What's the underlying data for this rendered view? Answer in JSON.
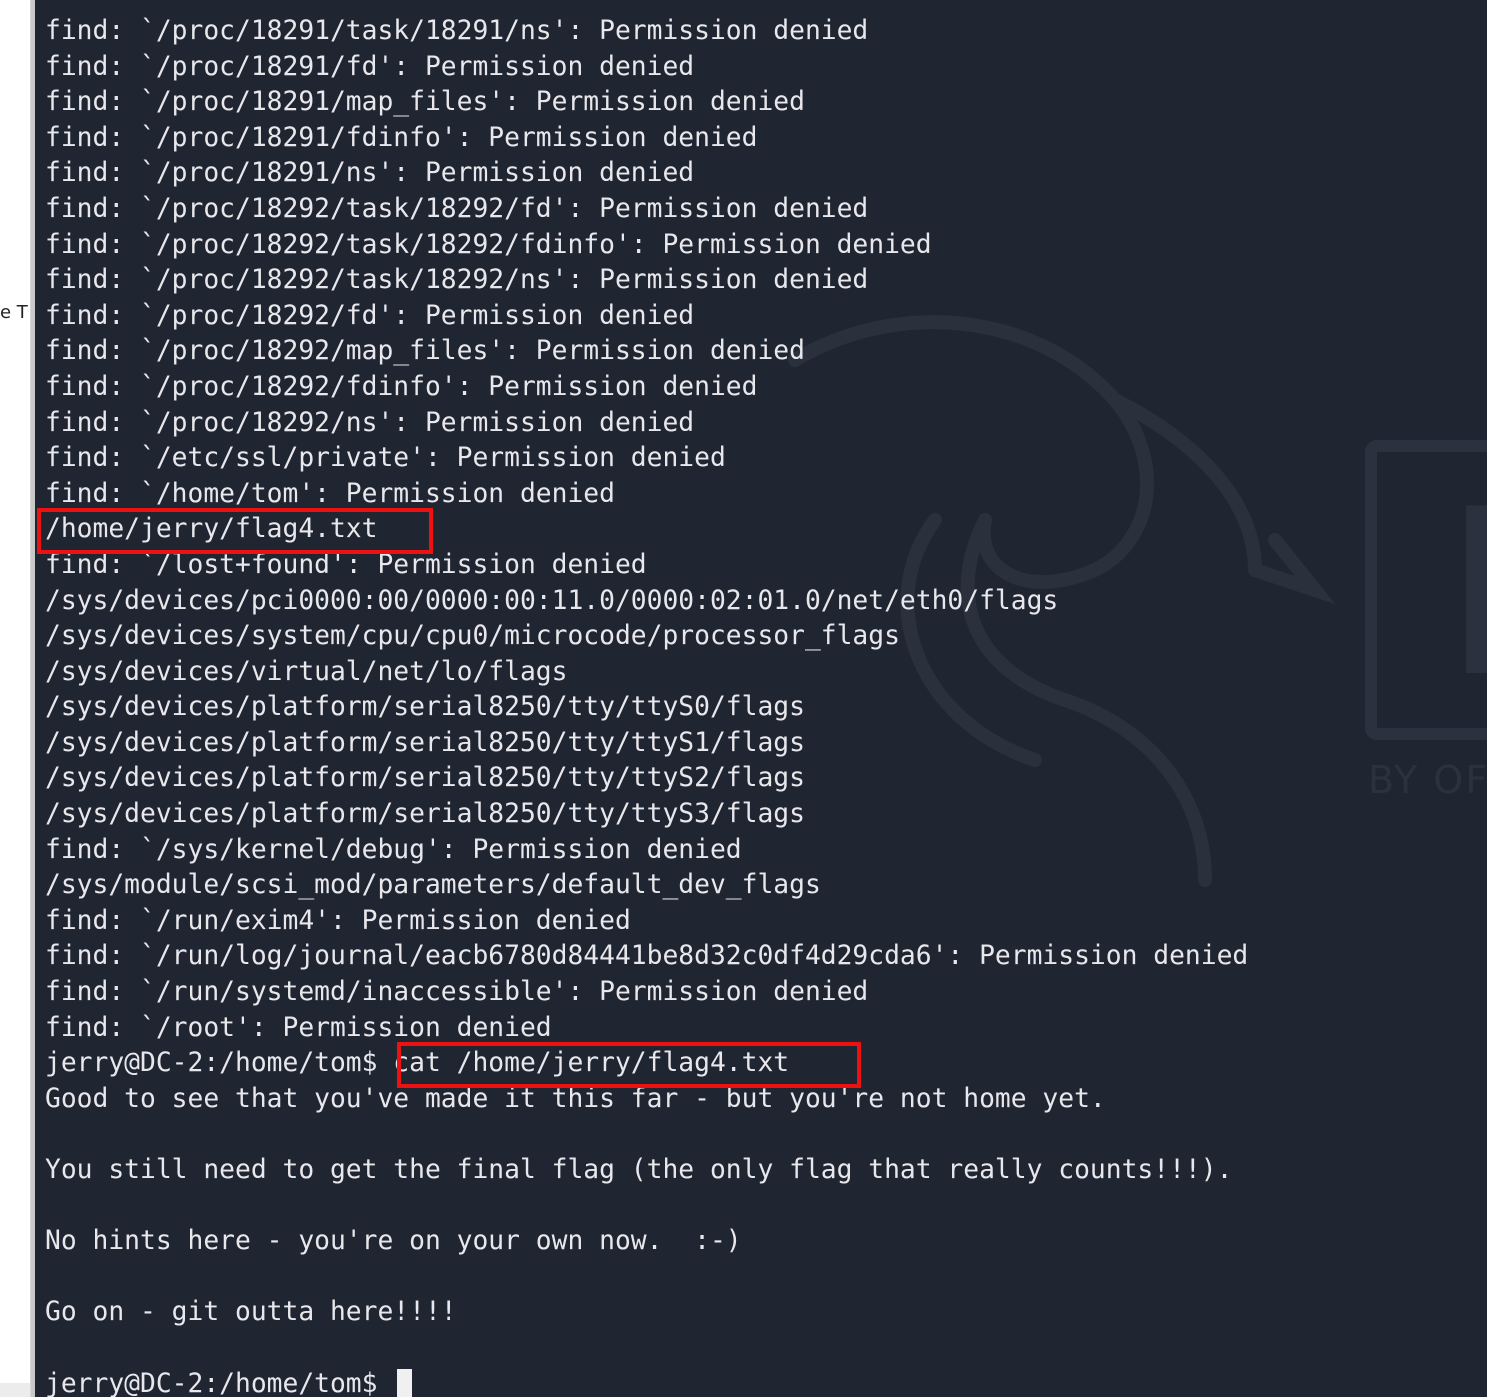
{
  "side_panel": {
    "stub_text": "e T"
  },
  "watermark": {
    "logo_letter": "K",
    "tagline": "BY OF"
  },
  "terminal": {
    "lines": [
      "find: `/proc/18291/task/18291/ns': Permission denied",
      "find: `/proc/18291/fd': Permission denied",
      "find: `/proc/18291/map_files': Permission denied",
      "find: `/proc/18291/fdinfo': Permission denied",
      "find: `/proc/18291/ns': Permission denied",
      "find: `/proc/18292/task/18292/fd': Permission denied",
      "find: `/proc/18292/task/18292/fdinfo': Permission denied",
      "find: `/proc/18292/task/18292/ns': Permission denied",
      "find: `/proc/18292/fd': Permission denied",
      "find: `/proc/18292/map_files': Permission denied",
      "find: `/proc/18292/fdinfo': Permission denied",
      "find: `/proc/18292/ns': Permission denied",
      "find: `/etc/ssl/private': Permission denied",
      "find: `/home/tom': Permission denied",
      "/home/jerry/flag4.txt",
      "find: `/lost+found': Permission denied",
      "/sys/devices/pci0000:00/0000:00:11.0/0000:02:01.0/net/eth0/flags",
      "/sys/devices/system/cpu/cpu0/microcode/processor_flags",
      "/sys/devices/virtual/net/lo/flags",
      "/sys/devices/platform/serial8250/tty/ttyS0/flags",
      "/sys/devices/platform/serial8250/tty/ttyS1/flags",
      "/sys/devices/platform/serial8250/tty/ttyS2/flags",
      "/sys/devices/platform/serial8250/tty/ttyS3/flags",
      "find: `/sys/kernel/debug': Permission denied",
      "/sys/module/scsi_mod/parameters/default_dev_flags",
      "find: `/run/exim4': Permission denied",
      "find: `/run/log/journal/eacb6780d84441be8d32c0df4d29cda6': Permission denied",
      "find: `/run/systemd/inaccessible': Permission denied",
      "find: `/root': Permission denied",
      "jerry@DC-2:/home/tom$ cat /home/jerry/flag4.txt",
      "Good to see that you've made it this far - but you're not home yet.",
      "",
      "You still need to get the final flag (the only flag that really counts!!!).",
      "",
      "No hints here - you're on your own now.  :-)",
      "",
      "Go on - git outta here!!!!",
      "",
      "jerry@DC-2:/home/tom$ "
    ],
    "highlight_color": "#ee1111",
    "text_color": "#e8e8ec",
    "background_color": "#202532"
  }
}
